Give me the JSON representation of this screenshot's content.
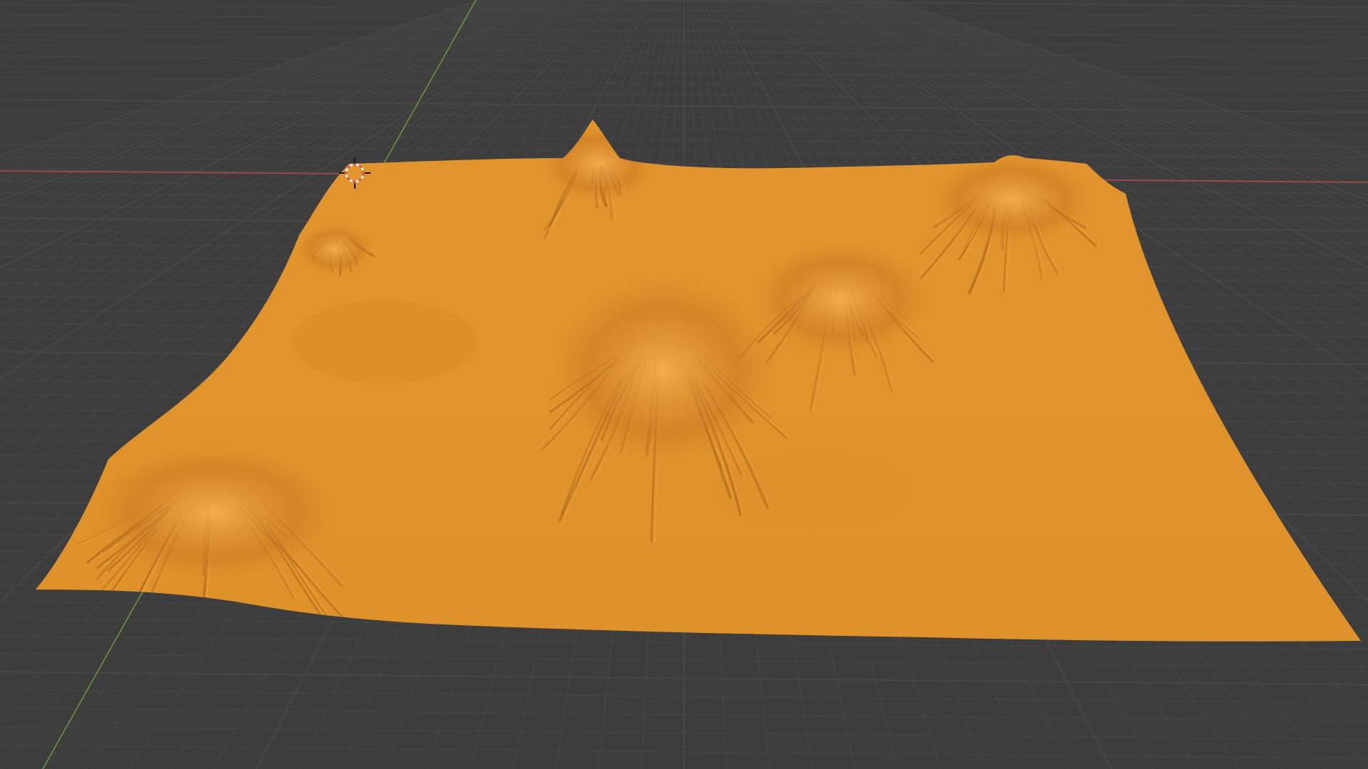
{
  "viewport": {
    "background_color": "#3d3d3d",
    "grid_line_color": "#4a4a4a",
    "x_axis_color": "#b34a52",
    "y_axis_color": "#6a9a3c"
  },
  "terrain": {
    "object": "terrain-mesh",
    "color": "#e3952d",
    "shade_color": "#a8661a",
    "highlight_color": "#f2ad48"
  },
  "cursor_3d": {
    "icon": "3d-cursor-icon",
    "ring_color_a": "#d9534f",
    "ring_color_b": "#f5f5f5"
  }
}
